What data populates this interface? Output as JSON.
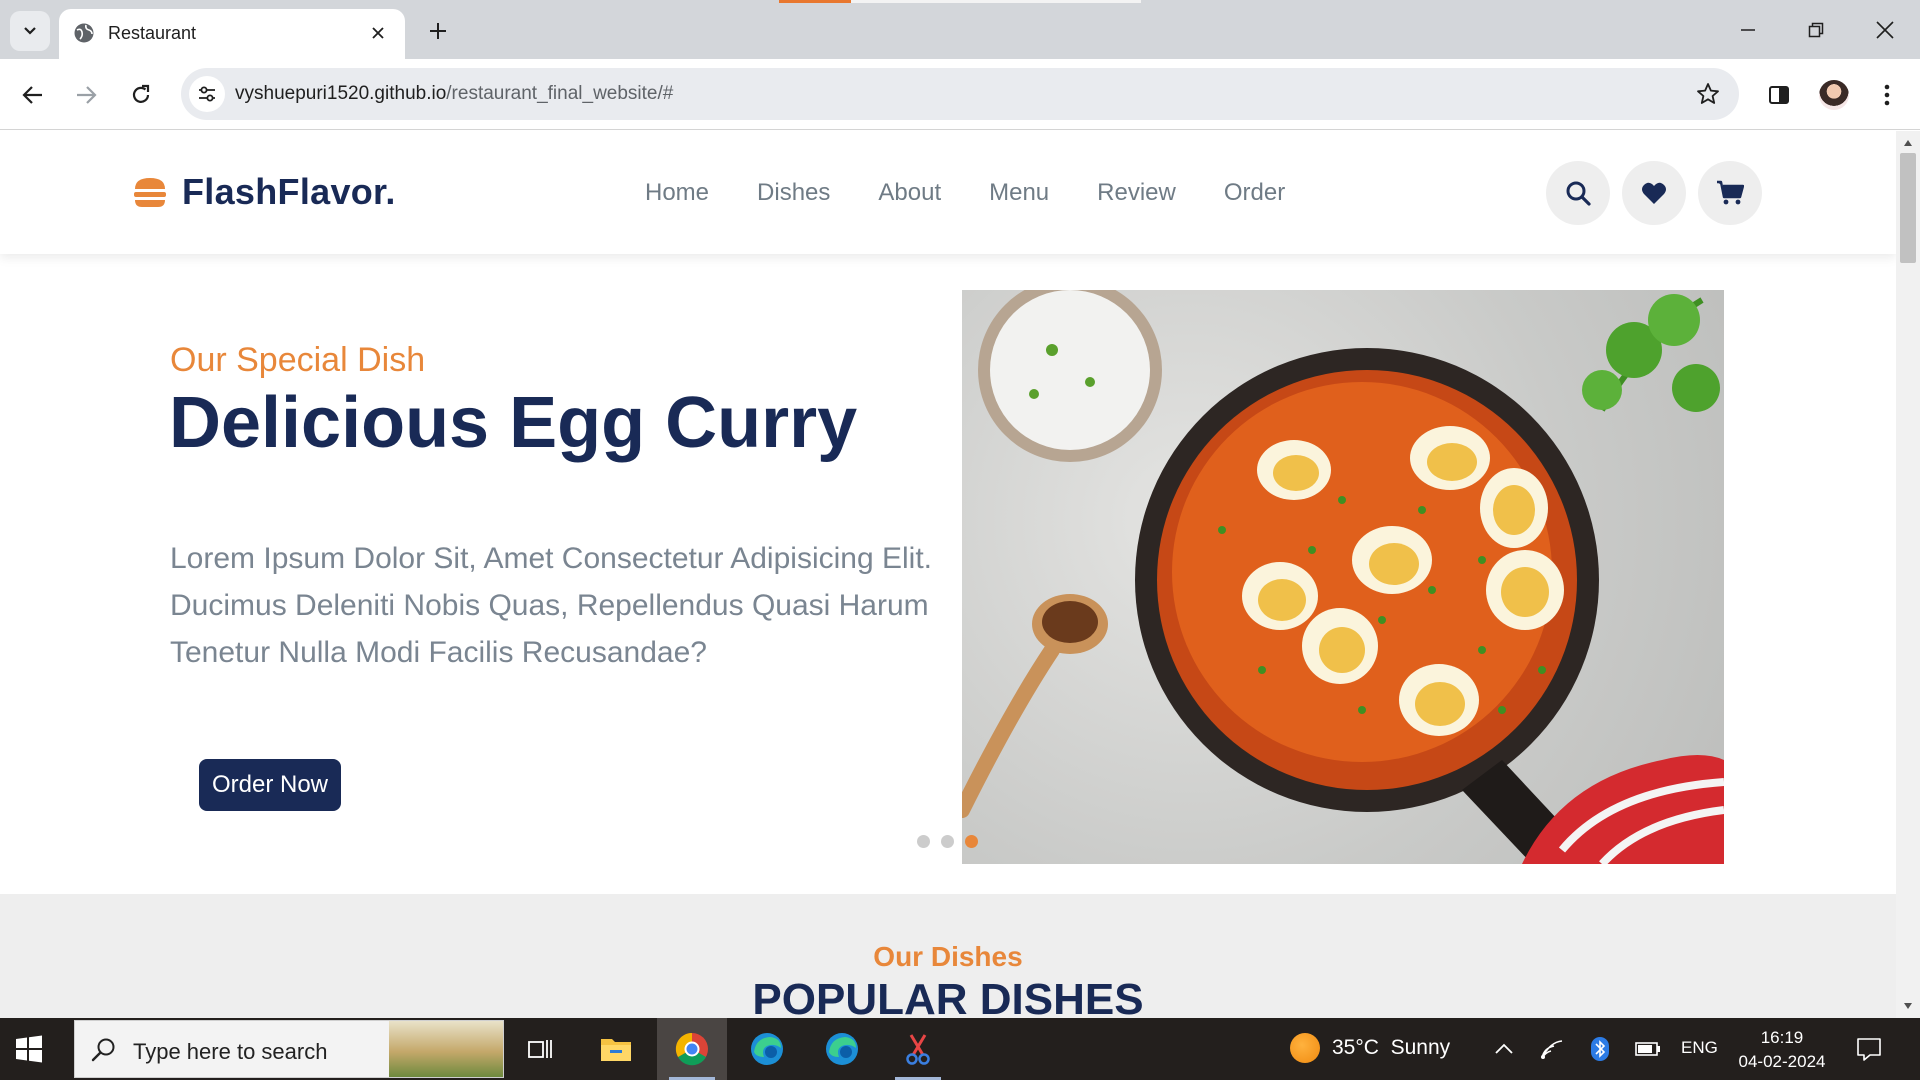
{
  "browser": {
    "tab_title": "Restaurant",
    "url_host": "vyshuepuri1520.github.io",
    "url_path": "/restaurant_final_website/#"
  },
  "site": {
    "logo_text": "FlashFlavor.",
    "nav": [
      "Home",
      "Dishes",
      "About",
      "Menu",
      "Review",
      "Order"
    ],
    "header_icons": [
      "search-icon",
      "heart-icon",
      "cart-icon"
    ]
  },
  "hero": {
    "subtitle": "Our Special Dish",
    "title": "Delicious Egg Curry",
    "description": "Lorem Ipsum Dolor Sit, Amet Consectetur Adipisicing Elit. Ducimus Deleniti Nobis Quas, Repellendus Quasi Harum Tenetur Nulla Modi Facilis Recusandae?",
    "button_label": "Order Now",
    "slides_count": 3,
    "active_slide": 3
  },
  "dishes": {
    "subtitle": "Our Dishes",
    "title": "POPULAR DISHES"
  },
  "taskbar": {
    "search_placeholder": "Type here to search",
    "weather": "35°C  Sunny",
    "language": "ENG",
    "time": "16:19",
    "date": "04-02-2024"
  },
  "colors": {
    "brand_navy": "#192a56",
    "accent_orange": "#e8873a"
  }
}
